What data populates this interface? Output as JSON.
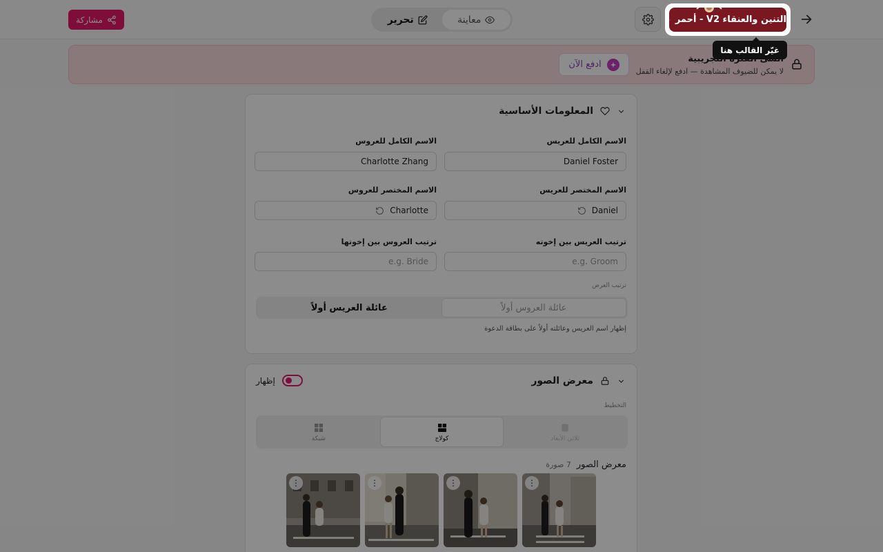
{
  "header": {
    "template_label": "التنين والعنقاء V2 - أحمر",
    "tooltip": "غيّر القالب هنا",
    "mode_edit": "تحرير",
    "mode_preview": "معاينة",
    "share_label": "مشاركة"
  },
  "banner": {
    "title": "أنشئ الفترة التجريبية",
    "subtitle": "لا يمكن للضيوف المشاهدة — ادفع لإلغاء القفل",
    "pay_label": "ادفع الآن"
  },
  "basic_info": {
    "title": "المعلومات الأساسية",
    "groom_full_label": "الاسم الكامل للعريس",
    "groom_full_value": "Daniel Foster",
    "bride_full_label": "الاسم الكامل للعروس",
    "bride_full_value": "Charlotte Zhang",
    "groom_short_label": "الاسم المختصر للعريس",
    "groom_short_value": "Daniel",
    "bride_short_label": "الاسم المختصر للعروس",
    "bride_short_value": "Charlotte",
    "groom_order_label": "ترتيب العريس بين إخوته",
    "groom_order_placeholder": "e.g. Groom",
    "bride_order_label": "ترتيب العروس بين إخوتها",
    "bride_order_placeholder": "e.g. Bride",
    "display_order_label": "ترتيب العرض",
    "groom_family_first": "عائلة العريس أولاً",
    "bride_family_first": "عائلة العروس أولاً",
    "display_hint": "إظهار اسم العريس وعائلته أولاً على بطاقة الدعوة"
  },
  "gallery": {
    "title": "معرض الصور",
    "show_label": "إظهار",
    "layout_label": "التخطيط",
    "layout_grid": "شبكة",
    "layout_collage": "كولاج",
    "layout_3d": "ثلاثي الأبعاد",
    "gallery_title": "معرض الصور",
    "photo_count": "7 صورة",
    "menu_glyph": "⋮"
  },
  "colors": {
    "accent": "#e5196b",
    "template": "#7a1822",
    "banner_bg": "#f9dde1"
  }
}
